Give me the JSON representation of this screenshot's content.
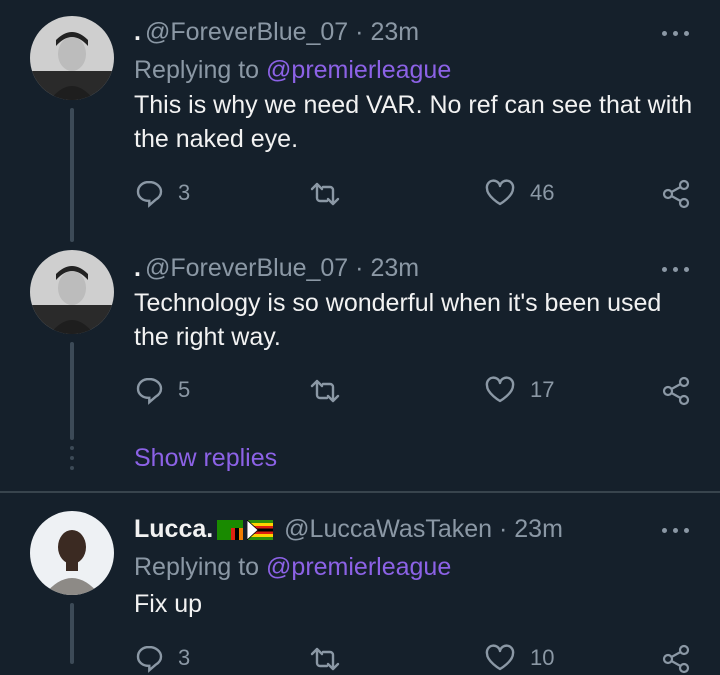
{
  "tweets": [
    {
      "prefix": ".",
      "handle": "@ForeverBlue_07",
      "sep": "·",
      "time": "23m",
      "replying_label": "Replying to",
      "replying_to": "@premierleague",
      "text": "This is why we need VAR. No ref can see that with the naked eye.",
      "replies": "3",
      "likes": "46"
    },
    {
      "prefix": ".",
      "handle": "@ForeverBlue_07",
      "sep": "·",
      "time": "23m",
      "text": "Technology is so wonderful when it's been used the right way.",
      "replies": "5",
      "likes": "17"
    },
    {
      "name": "Lucca.",
      "handle": "@LuccaWasTaken",
      "sep": "·",
      "time": "23m",
      "replying_label": "Replying to",
      "replying_to": "@premierleague",
      "text": "Fix up",
      "replies": "3",
      "likes": "10"
    }
  ],
  "show_replies": "Show replies",
  "colors": {
    "background": "#15202b",
    "accent": "#8c62e6",
    "muted": "#8b98a5",
    "text": "#f2f2f2"
  },
  "icons": [
    "reply-icon",
    "retweet-icon",
    "like-icon",
    "share-icon",
    "more-icon"
  ]
}
